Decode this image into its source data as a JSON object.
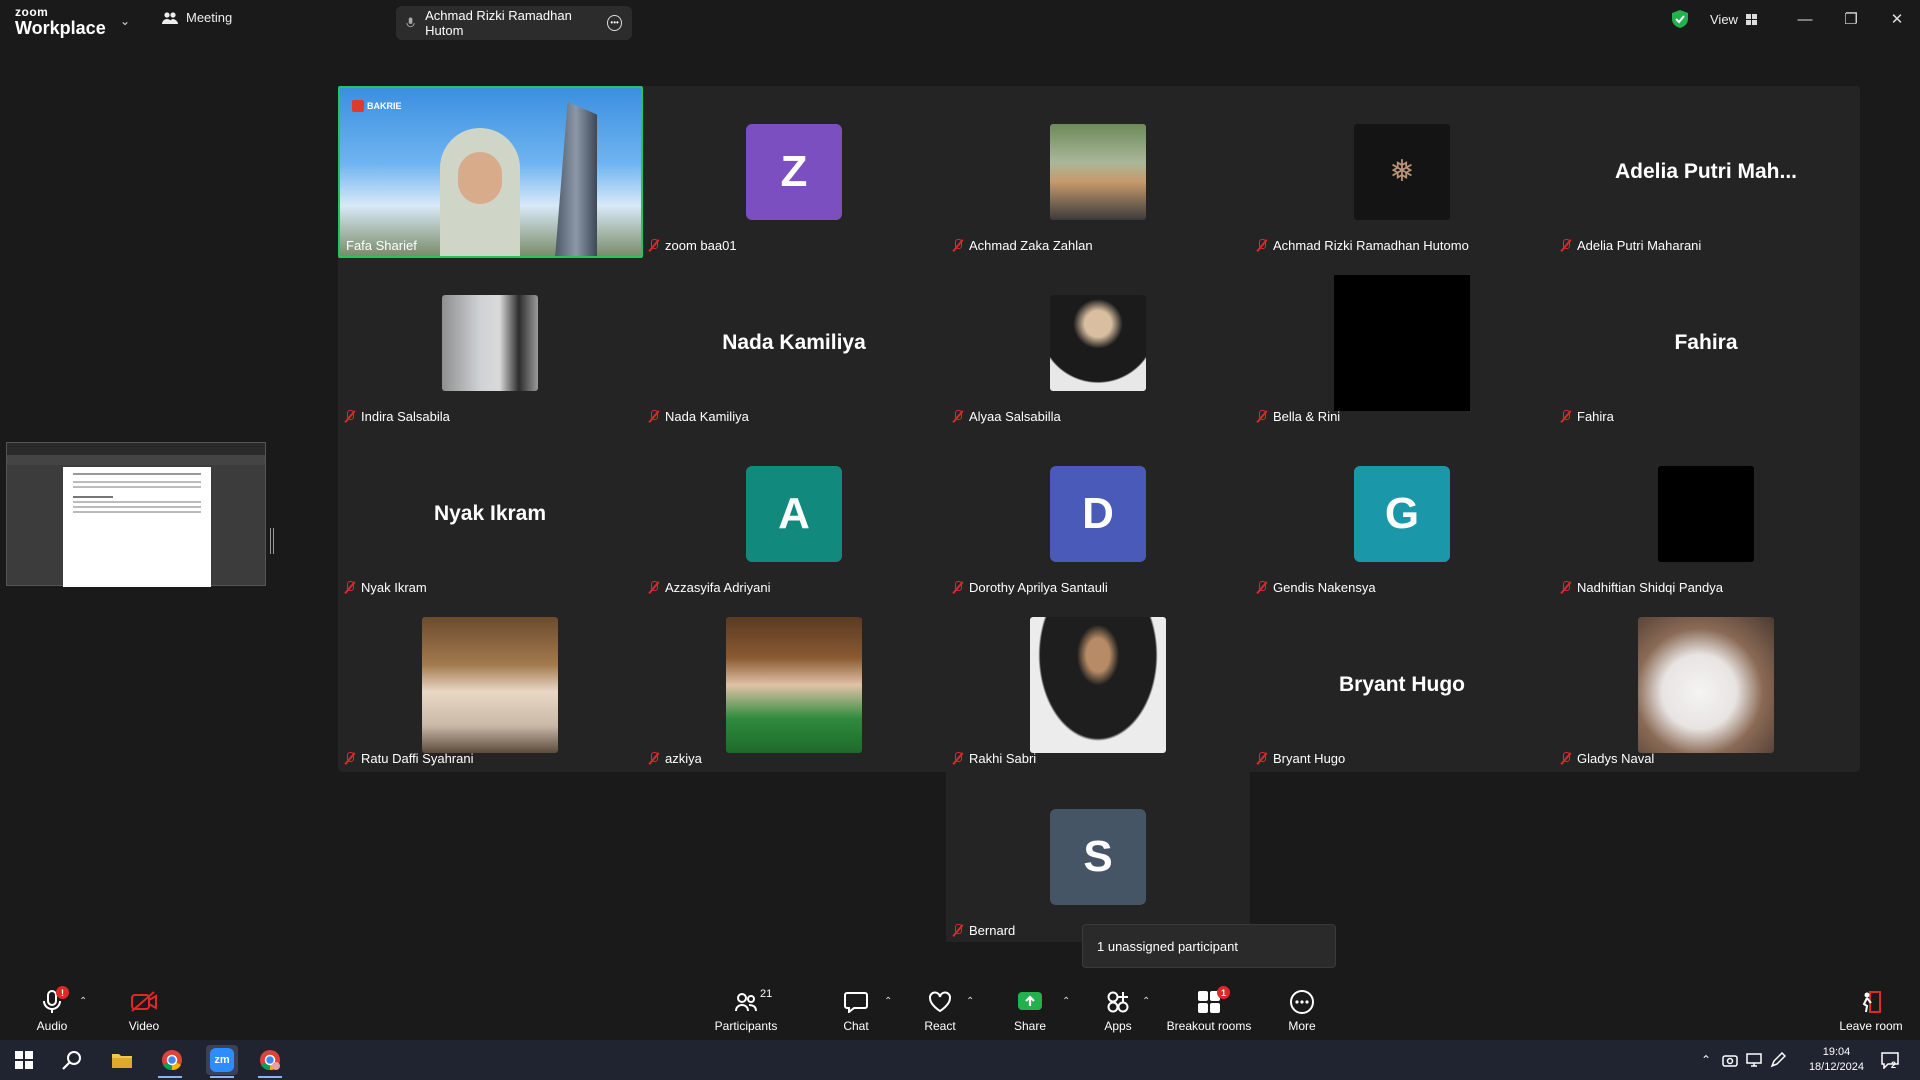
{
  "app": {
    "logo_top": "zoom",
    "logo_bottom": "Workplace",
    "meeting_label": "Meeting"
  },
  "speaker": {
    "name": "Achmad Rizki Ramadhan Hutom"
  },
  "view": {
    "label": "View"
  },
  "active_speaker": {
    "name": "Fafa Sharief",
    "banner": "BAKRIE"
  },
  "tiles": [
    {
      "name": "zoom baa01",
      "letter": "Z",
      "color": "#7b4fbf"
    },
    {
      "name": "Achmad Zaka Zahlan"
    },
    {
      "name": "Achmad Rizki Ramadhan Hutomo"
    },
    {
      "name": "Adelia Putri Maharani",
      "display": "Adelia Putri Mah..."
    },
    {
      "name": "Indira Salsabila"
    },
    {
      "name": "Nada Kamiliya",
      "display": "Nada Kamiliya"
    },
    {
      "name": "Alyaa Salsabilla"
    },
    {
      "name": "Bella & Rini"
    },
    {
      "name": "Fahira",
      "display": "Fahira"
    },
    {
      "name": "Nyak Ikram",
      "display": "Nyak Ikram"
    },
    {
      "name": "Azzasyifa Adriyani",
      "letter": "A",
      "color": "#11897c"
    },
    {
      "name": "Dorothy Aprilya Santauli",
      "letter": "D",
      "color": "#4a5ab8"
    },
    {
      "name": "Gendis Nakensya",
      "letter": "G",
      "color": "#1a97a8"
    },
    {
      "name": "Nadhiftian Shidqi Pandya"
    },
    {
      "name": "Ratu Daffi Syahrani"
    },
    {
      "name": "azkiya"
    },
    {
      "name": "Rakhi Sabri"
    },
    {
      "name": "Bryant Hugo",
      "display": "Bryant Hugo"
    },
    {
      "name": "Gladys Naval"
    }
  ],
  "bernard": {
    "name": "Bernard",
    "letter": "S",
    "color": "#455565"
  },
  "breakout_popup": "1 unassigned participant",
  "toolbar": {
    "audio": "Audio",
    "video": "Video",
    "participants": "Participants",
    "participants_count": "21",
    "chat": "Chat",
    "react": "React",
    "share": "Share",
    "apps": "Apps",
    "breakout": "Breakout rooms",
    "breakout_badge": "1",
    "more": "More",
    "leave": "Leave room",
    "audio_badge": "!"
  },
  "taskbar": {
    "time": "19:04",
    "date": "18/12/2024",
    "notif_count": "2",
    "zoom_label": "zm"
  }
}
